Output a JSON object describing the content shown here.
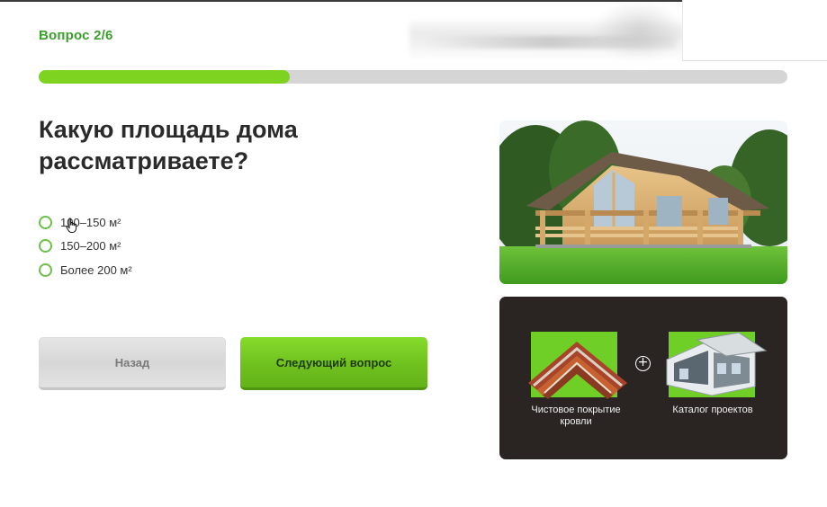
{
  "header": {
    "step_label": "Вопрос 2/6"
  },
  "progress": {
    "value": 2,
    "total": 6,
    "fraction": 0.335,
    "fill_color": "#7ed321",
    "track_color": "#d5d5d5"
  },
  "question": {
    "title": "Какую площадь дома рассматриваете?"
  },
  "options": [
    {
      "label": "100–150 м²",
      "selected": false
    },
    {
      "label": "150–200 м²",
      "selected": false
    },
    {
      "label": "Более 200 м²",
      "selected": false
    }
  ],
  "buttons": {
    "back_label": "Назад",
    "next_label": "Следующий вопрос"
  },
  "bonus": {
    "item1_label": "Чистовое покрытие кровли",
    "item2_label": "Каталог проектов"
  },
  "colors": {
    "accent_green": "#3aa02b",
    "button_green": "#6fc11e",
    "bonus_bg": "#2a2523"
  }
}
